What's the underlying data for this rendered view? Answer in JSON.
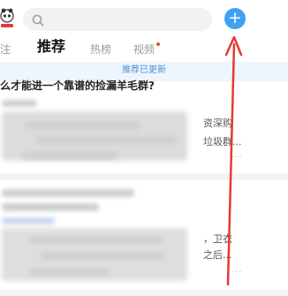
{
  "search": {
    "placeholder": ""
  },
  "add_button": {
    "label": "+"
  },
  "tabs": [
    {
      "label": "注"
    },
    {
      "label": "推荐"
    },
    {
      "label": "热榜"
    },
    {
      "label": "视频"
    }
  ],
  "banner": {
    "text": "推荐已更新"
  },
  "feed": {
    "headline": "么才能进一个靠谱的捡漏羊毛群?",
    "item1": {
      "line1": "资深购",
      "line2": "垃圾群..."
    },
    "item2": {
      "line1": "，卫衣",
      "line2": "之后..."
    },
    "more_label": "..."
  },
  "colors": {
    "accent": "#3ea2f5",
    "arrow": "#e53935",
    "banner_bg": "#eef5fe",
    "banner_text": "#4b8fd6"
  },
  "icons": {
    "logo": "panda-logo-icon",
    "search": "search-icon",
    "add": "plus-icon"
  }
}
